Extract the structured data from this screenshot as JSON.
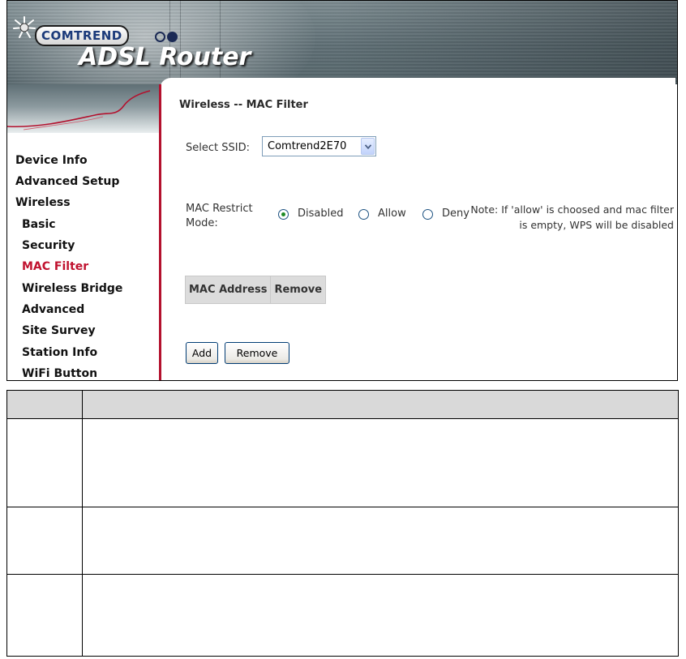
{
  "banner": {
    "brand": "COMTREND",
    "product": "ADSL Router"
  },
  "sidebar": {
    "items": [
      {
        "label": "Device Info",
        "level": 0,
        "active": false
      },
      {
        "label": "Advanced Setup",
        "level": 0,
        "active": false
      },
      {
        "label": "Wireless",
        "level": 0,
        "active": false
      },
      {
        "label": "Basic",
        "level": 1,
        "active": false
      },
      {
        "label": "Security",
        "level": 1,
        "active": false
      },
      {
        "label": "MAC Filter",
        "level": 1,
        "active": true
      },
      {
        "label": "Wireless Bridge",
        "level": 1,
        "active": false
      },
      {
        "label": "Advanced",
        "level": 1,
        "active": false
      },
      {
        "label": "Site Survey",
        "level": 1,
        "active": false
      },
      {
        "label": "Station Info",
        "level": 1,
        "active": false
      },
      {
        "label": "WiFi Button",
        "level": 1,
        "active": false
      }
    ]
  },
  "main": {
    "title": "Wireless -- MAC Filter",
    "ssid_label": "Select SSID:",
    "ssid_value": "Comtrend2E70",
    "mode_label": "MAC Restrict Mode:",
    "mode_options": [
      "Disabled",
      "Allow",
      "Deny"
    ],
    "mode_selected": "Disabled",
    "note": "Note: If 'allow' is choosed and mac filter is empty, WPS will be disabled",
    "table_headers": [
      "MAC Address",
      "Remove"
    ],
    "add_label": "Add",
    "remove_label": "Remove"
  },
  "colors": {
    "active_nav": "#c0122f",
    "sidebar_rule": "#b3112e",
    "banner_bg": "#6b7b80",
    "table_header_bg": "#dcdcdc"
  }
}
